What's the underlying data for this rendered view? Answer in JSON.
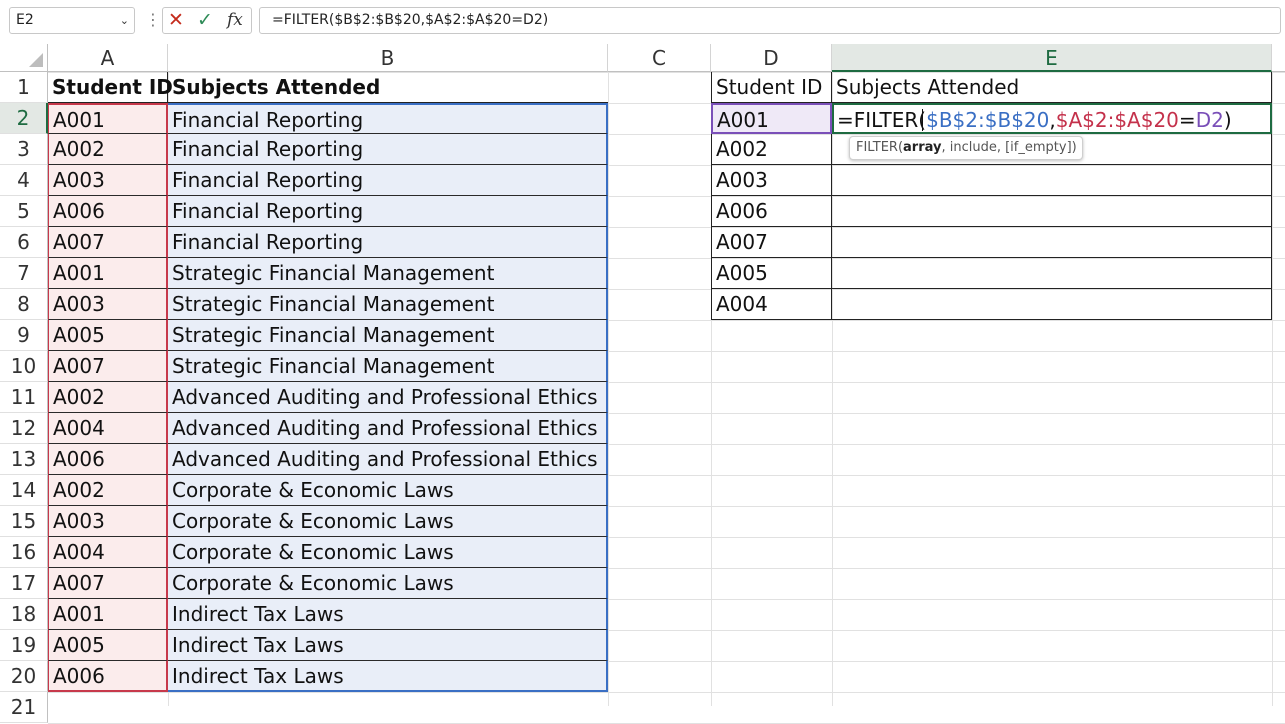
{
  "formula_bar": {
    "name_box": "E2",
    "formula": "=FILTER($B$2:$B$20,$A$2:$A$20=D2)"
  },
  "columns": [
    "A",
    "B",
    "C",
    "D",
    "E"
  ],
  "rows": [
    "1",
    "2",
    "3",
    "4",
    "5",
    "6",
    "7",
    "8",
    "9",
    "10",
    "11",
    "12",
    "13",
    "14",
    "15",
    "16",
    "17",
    "18",
    "19",
    "20",
    "21"
  ],
  "table_left": {
    "headers": [
      "Student ID",
      "Subjects Attended"
    ],
    "ids": [
      "A001",
      "A002",
      "A003",
      "A006",
      "A007",
      "A001",
      "A003",
      "A005",
      "A007",
      "A002",
      "A004",
      "A006",
      "A002",
      "A003",
      "A004",
      "A007",
      "A001",
      "A005",
      "A006"
    ],
    "subjects": [
      "Financial Reporting",
      "Financial Reporting",
      "Financial Reporting",
      "Financial Reporting",
      "Financial Reporting",
      "Strategic Financial Management",
      "Strategic Financial Management",
      "Strategic Financial Management",
      "Strategic Financial Management",
      "Advanced Auditing and Professional Ethics",
      "Advanced Auditing and Professional Ethics",
      "Advanced Auditing and Professional Ethics",
      "Corporate & Economic Laws",
      "Corporate & Economic Laws",
      "Corporate & Economic Laws",
      "Corporate & Economic Laws",
      "Indirect Tax Laws",
      "Indirect Tax Laws",
      "Indirect Tax Laws"
    ]
  },
  "table_right": {
    "headers": [
      "Student ID",
      "Subjects Attended"
    ],
    "ids": [
      "A001",
      "A002",
      "A003",
      "A006",
      "A007",
      "A005",
      "A004"
    ]
  },
  "edit_cell": {
    "prefix": "=FILTER(",
    "arg1": "$B$2:$B$20",
    "comma": ",",
    "arg2": "$A$2:$A$20",
    "eq": "=",
    "arg3": "D2",
    "suffix": ")"
  },
  "tooltip": {
    "fn": "FILTER(",
    "arg_bold": "array",
    "rest": ", include, [if_empty])"
  },
  "colors": {
    "accent_green": "#1e6b41",
    "ref_blue": "#3a6fc4",
    "ref_red": "#c4314b",
    "ref_purple": "#7a4fb8"
  }
}
